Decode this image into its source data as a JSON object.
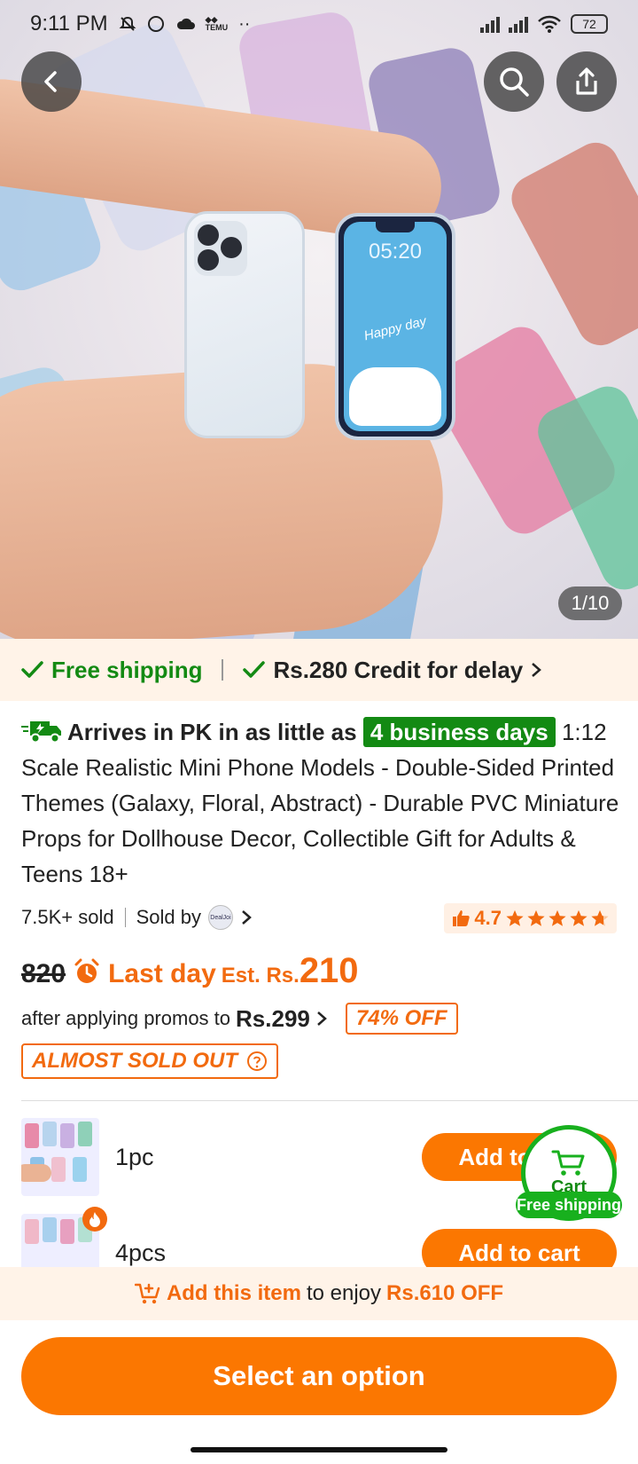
{
  "status_bar": {
    "time": "9:11 PM",
    "battery": "72"
  },
  "hero": {
    "counter": "1/10",
    "phone_time": "05:20",
    "phone_caption": "Happy day"
  },
  "shipping": {
    "free_shipping": "Free shipping",
    "credit": "Rs.280 Credit for delay"
  },
  "product": {
    "arrives_prefix": "Arrives in PK in as little as",
    "arrives_days": "4 business days",
    "title": "1:12 Scale Realistic Mini Phone Models - Double-Sided Printed Themes (Galaxy, Floral, Abstract) - Durable PVC Miniature Props for Dollhouse Decor, Collectible Gift for Adults & Teens 18+",
    "sold": "7.5K+ sold",
    "sold_by": "Sold by",
    "seller_logo_text": "DealJoi",
    "rating": "4.7",
    "stars": 4.7
  },
  "price": {
    "old_price": "820",
    "last_day": "Last day",
    "est_prefix": "Est. Rs.",
    "est_price": "210",
    "after_promo": "after applying promos to",
    "promo_price": "Rs.299",
    "discount": "74% OFF",
    "almost_sold_out": "ALMOST SOLD OUT"
  },
  "options": [
    {
      "label": "1pc",
      "button": "Add to cart"
    },
    {
      "label": "4pcs",
      "button": "Add to cart"
    }
  ],
  "cart_float": {
    "label": "Cart",
    "badge": "Free shipping"
  },
  "bundle_band": {
    "orange_text": "Add this item",
    "middle_text": "to enjoy",
    "savings": "Rs.610 OFF"
  },
  "select_option_label": "Select an option",
  "colors": {
    "accent": "#fb7701",
    "green": "#138a13",
    "band_bg": "#fff3e8"
  },
  "icons": [
    "back-arrow-icon",
    "search-icon",
    "share-icon",
    "check-icon",
    "truck-icon",
    "alarm-clock-icon",
    "help-circle-icon",
    "cart-icon",
    "fire-icon",
    "thumbs-up-icon",
    "star-icon"
  ]
}
